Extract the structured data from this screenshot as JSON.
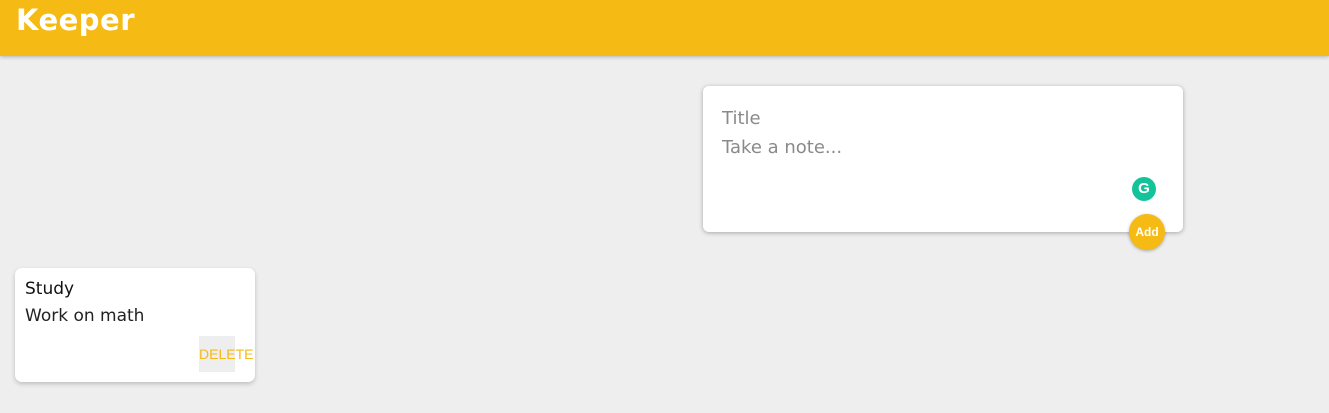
{
  "header": {
    "app_name": "Keeper",
    "brand_color": "#f5ba13"
  },
  "create_note": {
    "title_placeholder": "Title",
    "content_placeholder": "Take a note...",
    "extension_icon": "grammarly-icon",
    "add_label": "Add"
  },
  "notes": [
    {
      "title": "Study",
      "content": "Work on math",
      "delete_label": "DELETE"
    }
  ]
}
